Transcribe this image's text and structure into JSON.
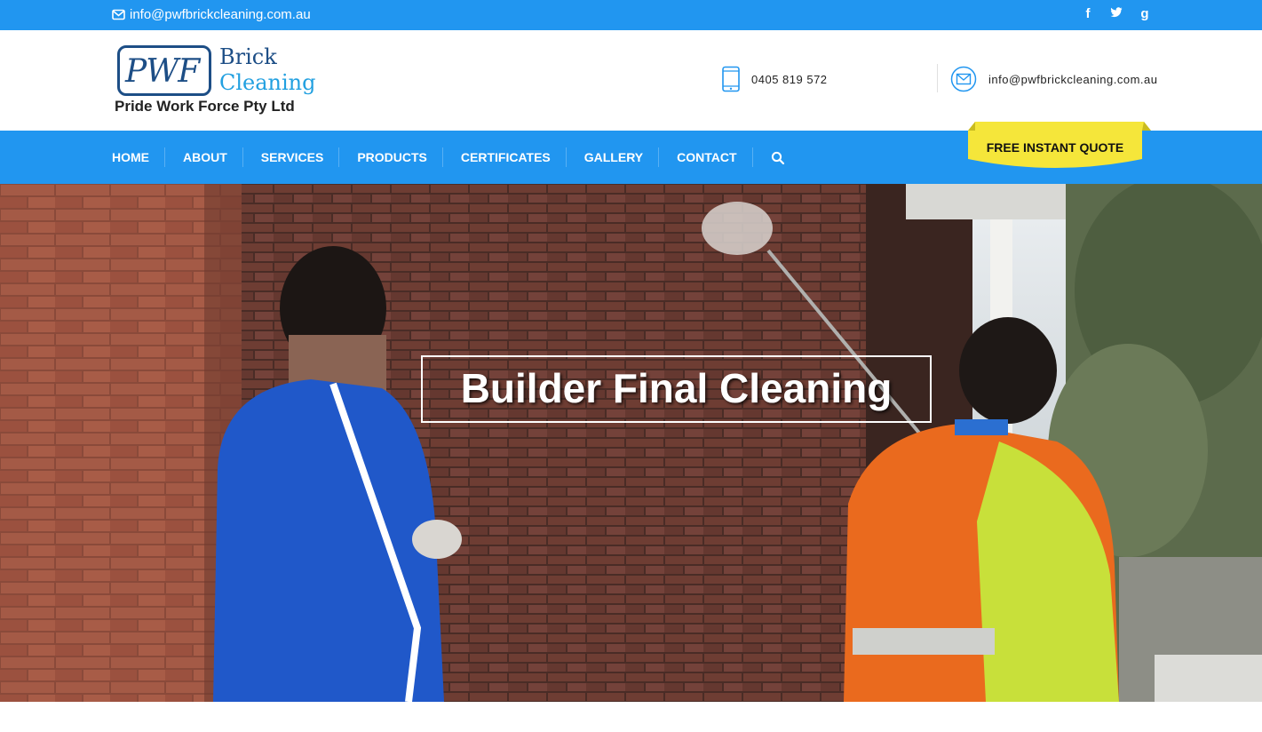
{
  "topbar": {
    "email": "info@pwfbrickcleaning.com.au",
    "socials": [
      {
        "icon": "facebook-icon",
        "glyph": "f"
      },
      {
        "icon": "twitter-icon",
        "glyph": "t"
      },
      {
        "icon": "google-plus-icon",
        "glyph": "g"
      }
    ]
  },
  "logo": {
    "monogram": "PWF",
    "line1": "Brick",
    "line2": "Cleaning",
    "tagline": "Pride Work Force Pty Ltd"
  },
  "header_contact": {
    "phone": "0405 819 572",
    "email": "info@pwfbrickcleaning.com.au"
  },
  "nav": {
    "items": [
      "HOME",
      "ABOUT",
      "SERVICES",
      "PRODUCTS",
      "CERTIFICATES",
      "GALLERY",
      "CONTACT"
    ],
    "quote_label": "FREE INSTANT QUOTE"
  },
  "hero": {
    "title": "Builder Final Cleaning"
  },
  "colors": {
    "primary_blue": "#2196f0",
    "quote_yellow": "#f5e63a",
    "logo_navy": "#1d4e86",
    "logo_cyan": "#22a0e0"
  }
}
